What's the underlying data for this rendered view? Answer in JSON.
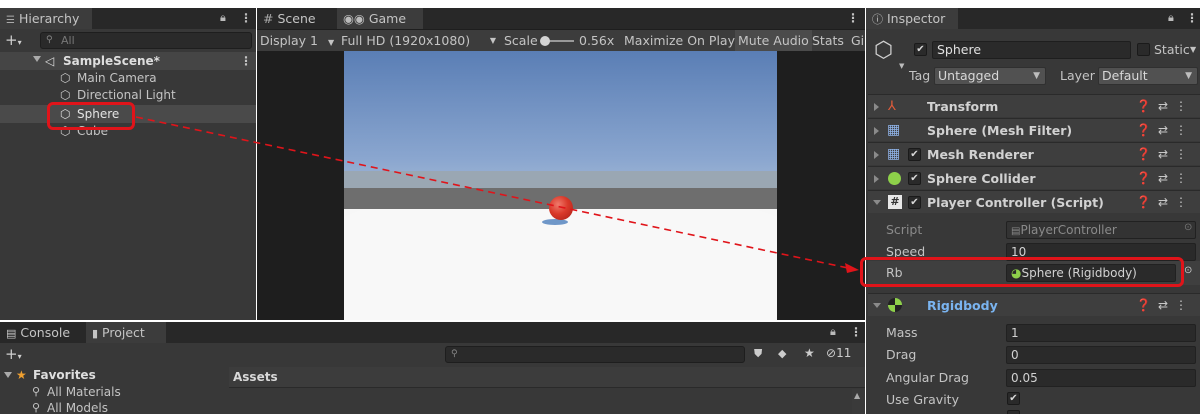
{
  "hierarchy": {
    "tab_label": "Hierarchy",
    "search_placeholder": "All",
    "scene_name": "SampleScene*",
    "items": [
      "Main Camera",
      "Directional Light",
      "Sphere",
      "Cube"
    ]
  },
  "center_tabs": {
    "scene": "Scene",
    "game": "Game"
  },
  "game_toolbar": {
    "display": "Display 1",
    "resolution": "Full HD (1920x1080)",
    "scale_label": "Scale",
    "scale_value": "0.56x",
    "maximize": "Maximize On Play",
    "mute": "Mute Audio",
    "stats": "Stats",
    "gizmos": "Gi"
  },
  "inspector": {
    "tab_label": "Inspector",
    "object_name": "Sphere",
    "static_label": "Static",
    "tag_label": "Tag",
    "tag_value": "Untagged",
    "layer_label": "Layer",
    "layer_value": "Default",
    "components": [
      {
        "label": "Transform"
      },
      {
        "label": "Sphere (Mesh Filter)"
      },
      {
        "label": "Mesh Renderer"
      },
      {
        "label": "Sphere Collider"
      },
      {
        "label": "Player Controller (Script)"
      }
    ],
    "script_label": "Script",
    "script_value": "PlayerController",
    "speed_label": "Speed",
    "speed_value": "10",
    "rb_label": "Rb",
    "rb_value": "Sphere (Rigidbody)",
    "rigidbody": {
      "label": "Rigidbody",
      "mass_label": "Mass",
      "mass_value": "1",
      "drag_label": "Drag",
      "drag_value": "0",
      "angular_drag_label": "Angular Drag",
      "angular_drag_value": "0.05",
      "use_gravity_label": "Use Gravity"
    }
  },
  "bottom": {
    "console_tab": "Console",
    "project_tab": "Project",
    "favorites_label": "Favorites",
    "favorites_items": [
      "All Materials",
      "All Models"
    ],
    "assets_label": "Assets",
    "hidden_count": "11"
  },
  "colors": {
    "highlight": "#e0141a",
    "panel": "#383838",
    "rigidbody_label": "#7ab4f0"
  }
}
